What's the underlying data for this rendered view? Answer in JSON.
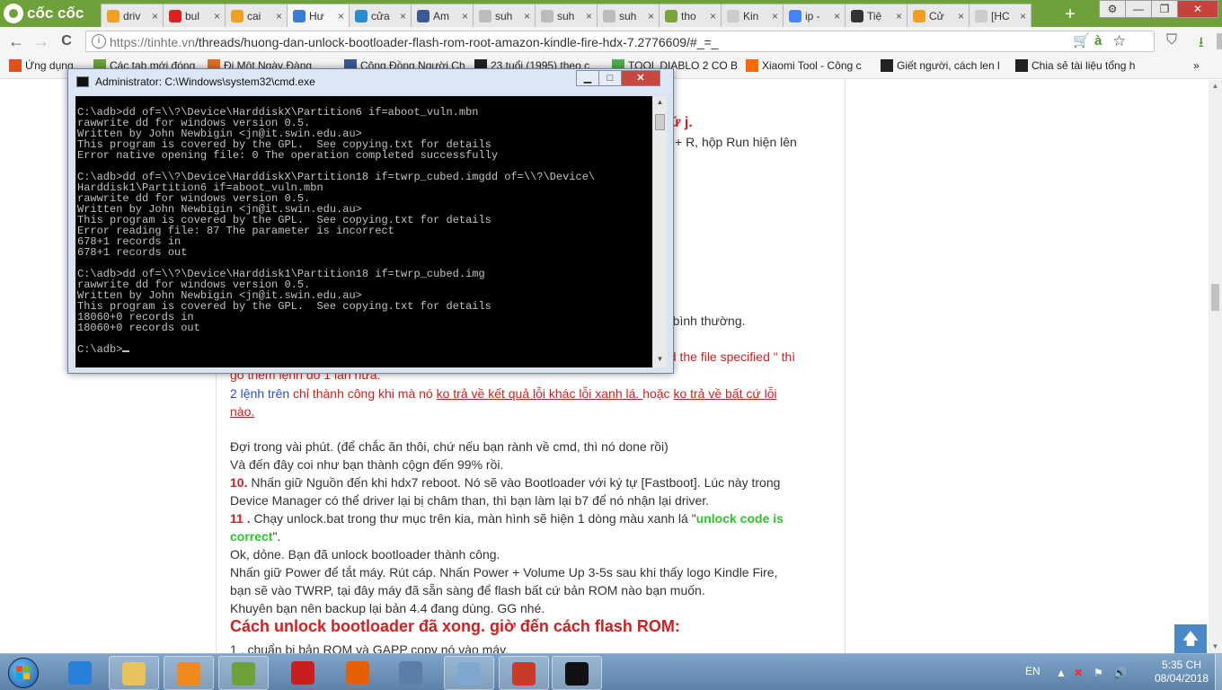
{
  "browser": {
    "brand": "cốc cốc",
    "tabs": [
      {
        "label": "driv",
        "color": "#f0a020"
      },
      {
        "label": "bul",
        "color": "#e02020"
      },
      {
        "label": "cai",
        "color": "#f0a020"
      },
      {
        "label": "Hư",
        "color": "#3a7bd5",
        "active": true
      },
      {
        "label": "cửa",
        "color": "#2a8dd4"
      },
      {
        "label": "Am",
        "color": "#3b5998"
      },
      {
        "label": "suh",
        "color": "#bbbbbb"
      },
      {
        "label": "suh",
        "color": "#bbbbbb"
      },
      {
        "label": "suh",
        "color": "#bbbbbb"
      },
      {
        "label": "tho",
        "color": "#7aa33a"
      },
      {
        "label": "Kin",
        "color": "#cccccc"
      },
      {
        "label": "ip -",
        "color": "#4285f4"
      },
      {
        "label": "Tiệ",
        "color": "#333333"
      },
      {
        "label": "Cử",
        "color": "#f0a020"
      },
      {
        "label": "[HC",
        "color": "#cccccc"
      }
    ],
    "tab_close": "×",
    "new_tab": "+",
    "window_controls": {
      "settings": "⚙",
      "minimize": "—",
      "maximize": "❐",
      "close": "✕"
    },
    "nav": {
      "back": "←",
      "forward": "→",
      "reload": "C"
    },
    "url_host": "https://tinhte.vn",
    "url_path": "/threads/huong-dan-unlock-bootloader-flash-rom-root-amazon-kindle-fire-hdx-7.2776609/#_=_",
    "omni_icons": {
      "cart": "🛒",
      "translate": "à",
      "star": "☆",
      "download": "⇩"
    },
    "bookmarks": [
      {
        "label": "Ứng dụng",
        "color": "#e0501e"
      },
      {
        "label": "Các tab mới đóng",
        "color": "#6ea13a"
      },
      {
        "label": "Đi Một Ngày Đàng",
        "color": "#e07020"
      },
      {
        "label": "Cộng Đồng Người Ch",
        "color": "#3b5998"
      },
      {
        "label": "23 tuổi (1995) theo c",
        "color": "#222222"
      },
      {
        "label": "TOOL DIABLO 2 CO B",
        "color": "#4caf50"
      },
      {
        "label": "Xiaomi Tool - Công c",
        "color": "#ff6a00"
      },
      {
        "label": "Giết người, cách len l",
        "color": "#222222"
      },
      {
        "label": "Chia sẻ tài liệu tổng h",
        "color": "#222222"
      }
    ],
    "bookmarks_more": "»"
  },
  "page": {
    "frag1": "cứ j.",
    "frag2": "w + R, hộp Run hiện lên",
    "frag3": "à bình thường.",
    "frag4": "nd the file specified \" thì",
    "frag5": "gõ thêm lệnh đó 1 lần nữa.",
    "l1a": "2 lệnh trên",
    "l1b": " chỉ thành công khi mà nó ",
    "l1c": "ko trả về kết quả lỗi khác lỗi xanh lá. ",
    "l1d": "hoặc ",
    "l1e": "ko trả về bất cứ lỗi",
    "l2": "nào.",
    "l3": "Đợi trong vài phút. (để chắc ăn thôi, chứ nếu bạn rành về cmd, thì nó done rồi)",
    "l4": "Và đến đây coi như bạn thành cộgn đến 99% rồi.",
    "l5num": "10.",
    "l5": " Nhấn giữ Nguồn đến khi hdx7 reboot. Nó sẽ vào Bootloader với ký tự [Fastboot]. Lúc này trong",
    "l6": "Device Manager có thể driver lại bị châm than, thì bạn làm lại b7 để nó nhận lại driver.",
    "l7num": "11 .",
    "l7": " Chạy unlock.bat trong thư mục trên kia, màn hình sẽ hiện 1 dòng màu xanh lá \"",
    "l7green": "unlock code is",
    "l8green": "correct",
    "l8": "\".",
    "l9": "Ok, dỏne. Bạn đã unlock bootloader thành công.",
    "l10": "Nhấn giữ Power để tắt máy. Rút cáp. Nhấn Power + Volume Up 3-5s sau khi thấy logo Kindle Fire,",
    "l11": "bạn sẽ vào TWRP, tại đây máy đã sẵn sàng để flash bất cứ bản ROM nào bạn muốn.",
    "l12": "Khuyên bạn nên backup lại bản 4.4 đang dùng. GG nhé.",
    "heading": "Cách unlock bootloader đã xong. giờ đến cách flash ROM:",
    "l13": "1 . chuẩn bị bản ROM và GAPP copy nó vào máy.",
    "to_top": "🡅"
  },
  "cmd": {
    "title": "Administrator: C:\\Windows\\system32\\cmd.exe",
    "controls": {
      "minimize": "▁",
      "maximize": "□",
      "close": "✕"
    },
    "output": "C:\\adb>dd of=\\\\?\\Device\\HarddiskX\\Partition6 if=aboot_vuln.mbn\nrawwrite dd for windows version 0.5.\nWritten by John Newbigin <jn@it.swin.edu.au>\nThis program is covered by the GPL.  See copying.txt for details\nError native opening file: 0 The operation completed successfully\n\nC:\\adb>dd of=\\\\?\\Device\\HarddiskX\\Partition18 if=twrp_cubed.imgdd of=\\\\?\\Device\\\nHarddisk1\\Partition6 if=aboot_vuln.mbn\nrawwrite dd for windows version 0.5.\nWritten by John Newbigin <jn@it.swin.edu.au>\nThis program is covered by the GPL.  See copying.txt for details\nError reading file: 87 The parameter is incorrect\n678+1 records in\n678+1 records out\n\nC:\\adb>dd of=\\\\?\\Device\\Harddisk1\\Partition18 if=twrp_cubed.img\nrawwrite dd for windows version 0.5.\nWritten by John Newbigin <jn@it.swin.edu.au>\nThis program is covered by the GPL.  See copying.txt for details\n18060+0 records in\n18060+0 records out\n\n",
    "prompt": "C:\\adb>"
  },
  "taskbar": {
    "items": [
      {
        "name": "internet-explorer",
        "color": "#2a7fd8"
      },
      {
        "name": "file-explorer",
        "color": "#e8c25a"
      },
      {
        "name": "media-player",
        "color": "#f08a1e"
      },
      {
        "name": "coccoc-browser",
        "color": "#6ea13a"
      },
      {
        "name": "garena",
        "color": "#c81e1e"
      },
      {
        "name": "firefox",
        "color": "#e66000"
      },
      {
        "name": "network-tool",
        "color": "#5a7fa8"
      },
      {
        "name": "control-panel",
        "color": "#7fa8d0"
      },
      {
        "name": "toolbox",
        "color": "#c83a2a"
      },
      {
        "name": "command-prompt",
        "color": "#111111"
      }
    ],
    "lang": "EN",
    "time": "5:35 CH",
    "date": "08/04/2018"
  }
}
